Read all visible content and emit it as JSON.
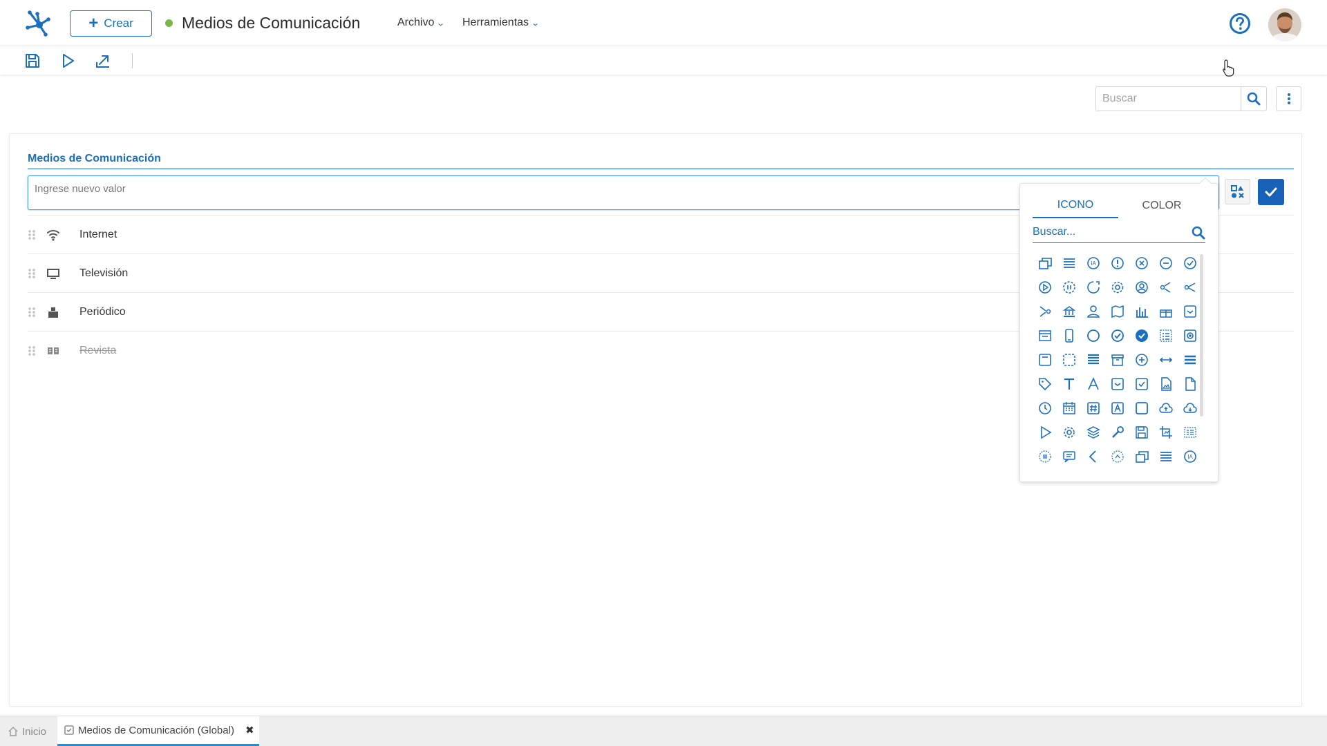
{
  "header": {
    "create_label": "Crear",
    "title": "Medios de Comunicación",
    "status_color": "#7ab648",
    "menus": [
      {
        "label": "Archivo"
      },
      {
        "label": "Herramientas"
      }
    ],
    "help_icon": "question-circle-icon",
    "avatar": "user-avatar"
  },
  "toolbar": {
    "icons": [
      "save-icon",
      "play-icon",
      "export-icon"
    ]
  },
  "search": {
    "placeholder": "Buscar"
  },
  "card": {
    "title": "Medios de Comunicación",
    "new_value_placeholder": "Ingrese nuevo valor",
    "items": [
      {
        "label": "Internet",
        "icon": "wifi-icon",
        "disabled": false
      },
      {
        "label": "Televisión",
        "icon": "monitor-icon",
        "disabled": false
      },
      {
        "label": "Periódico",
        "icon": "newspaper-icon",
        "disabled": false
      },
      {
        "label": "Revista",
        "icon": "book-open-icon",
        "disabled": true
      }
    ]
  },
  "icon_picker": {
    "tabs": [
      {
        "label": "ICONO",
        "active": true
      },
      {
        "label": "COLOR",
        "active": false
      }
    ],
    "search_placeholder": "Buscar...",
    "accent_color": "#1a6fbf",
    "icons": [
      "stack-icon",
      "list-icon",
      "ia-icon",
      "stack-alt-icon",
      "alert-circle-icon",
      "x-circle-icon",
      "minus-circle-icon",
      "check-circle-icon",
      "play-circle-icon",
      "play-dashed-icon",
      "pause-dashed-icon",
      "refresh-circle-icon",
      "gear-icon",
      "user-circle-icon",
      "branch-left-icon",
      "branch-mid-icon",
      "merge-icon",
      "merge-alt-icon",
      "bank-icon",
      "person-icon",
      "map-icon",
      "bar-chart-icon",
      "gift-icon",
      "dropdown-icon",
      "browser-icon",
      "mobile-icon",
      "circle-icon",
      "check-circle-alt-icon",
      "check-filled-icon",
      "list-box-icon",
      "radio-box-icon",
      "form-icon",
      "select-dashed-icon",
      "rows-icon",
      "archive-icon",
      "plus-circle-icon",
      "arrows-h-icon",
      "align-icon",
      "tag-icon",
      "text-icon",
      "font-icon",
      "checkbox-dropdown-icon",
      "checkbox-icon",
      "image-file-icon",
      "file-icon",
      "clock-icon",
      "calendar-icon",
      "hash-icon",
      "font-box-icon",
      "square-icon",
      "cloud-upload-icon",
      "cloud-download-icon",
      "triangle-play-icon",
      "cog-icon",
      "layers-icon",
      "wrench-icon",
      "floppy-icon",
      "crop-icon",
      "grid-list-icon",
      "circle-lines-icon",
      "comment-icon",
      "chevron-left-icon",
      "circle-faded-icon"
    ]
  },
  "bottom_tabs": [
    {
      "label": "Inicio",
      "icon": "home-icon"
    },
    {
      "label": "Medios de Comunicación (Global)",
      "icon": "list-check-icon",
      "active": true
    }
  ]
}
